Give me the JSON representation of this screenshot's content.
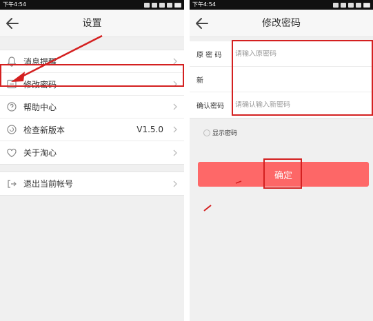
{
  "left": {
    "status_time": "下午4:54",
    "title": "设置",
    "items": [
      {
        "label": "消息提醒",
        "icon": "bell-icon"
      },
      {
        "label": "修改密码",
        "icon": "edit-icon"
      },
      {
        "label": "帮助中心",
        "icon": "help-icon"
      },
      {
        "label": "检查新版本",
        "icon": "refresh-icon",
        "value": "V1.5.0"
      },
      {
        "label": "关于淘心",
        "icon": "heart-icon"
      }
    ],
    "logout": {
      "label": "退出当前帐号",
      "icon": "exit-icon"
    }
  },
  "right": {
    "status_time": "下午4:54",
    "title": "修改密码",
    "fields": [
      {
        "label": "原 密 码",
        "placeholder": "请输入原密码"
      },
      {
        "label": "新",
        "placeholder": ""
      },
      {
        "label": "确认密码",
        "placeholder": "请确认输入新密码"
      }
    ],
    "show_password": "显示密码",
    "confirm": "确定"
  },
  "colors": {
    "accent": "#ff5c5c",
    "highlight": "#d42020"
  }
}
